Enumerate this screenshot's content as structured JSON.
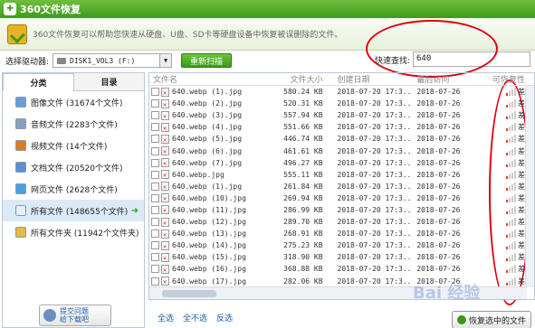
{
  "window": {
    "title": "360文件恢复"
  },
  "banner": {
    "description": "360文件恢复可以帮助您快速从硬盘、U盘、SD卡等硬盘设备中恢复被误删除的文件。"
  },
  "toolbar": {
    "drive_label": "选择驱动器:",
    "drive_value": "DISK1_VOL3 (F:)",
    "rescan_label": "重新扫描",
    "search_label": "快速查找:",
    "search_value": "640"
  },
  "sidebar": {
    "tabs": [
      "分类",
      "目录"
    ],
    "categories": [
      {
        "label": "图像文件 (31674个文件)",
        "icon": "image-icon",
        "color": "#6a9fd4"
      },
      {
        "label": "音频文件 (2283个文件)",
        "icon": "music-icon",
        "color": "#8aa0b8"
      },
      {
        "label": "视频文件 (14个文件)",
        "icon": "video-icon",
        "color": "#e07a1f"
      },
      {
        "label": "文档文件 (20520个文件)",
        "icon": "document-icon",
        "color": "#5b8fd0"
      },
      {
        "label": "网页文件 (2628个文件)",
        "icon": "web-icon",
        "color": "#4aa0e0"
      },
      {
        "label": "所有文件 (148655个文件)",
        "icon": "file-icon",
        "color": "#e8eef5"
      },
      {
        "label": "所有文件夹 (11942个文件夹)",
        "icon": "folder-icon",
        "color": "#e8b84a"
      }
    ],
    "help": {
      "line1": "提交问题",
      "line2": "给下载吧"
    }
  },
  "table": {
    "headers": [
      "文件名",
      "文件大小",
      "创建日期",
      "最后访问",
      "可恢复性"
    ],
    "rows": [
      {
        "name": "640.webp (1).jpg",
        "size": "580.24 KB",
        "created": "2018-07-20 17:3...",
        "accessed": "2018-07-26",
        "recover": "差"
      },
      {
        "name": "640.webp (2).jpg",
        "size": "520.31 KB",
        "created": "2018-07-20 17:3...",
        "accessed": "2018-07-26",
        "recover": "差"
      },
      {
        "name": "640.webp (3).jpg",
        "size": "557.94 KB",
        "created": "2018-07-20 17:3...",
        "accessed": "2018-07-26",
        "recover": "差"
      },
      {
        "name": "640.webp (4).jpg",
        "size": "551.66 KB",
        "created": "2018-07-20 17:3...",
        "accessed": "2018-07-26",
        "recover": "差"
      },
      {
        "name": "640.webp (5).jpg",
        "size": "446.74 KB",
        "created": "2018-07-20 17:3...",
        "accessed": "2018-07-26",
        "recover": "差"
      },
      {
        "name": "640.webp (6).jpg",
        "size": "461.61 KB",
        "created": "2018-07-20 17:3...",
        "accessed": "2018-07-26",
        "recover": "差"
      },
      {
        "name": "640.webp (7).jpg",
        "size": "496.27 KB",
        "created": "2018-07-20 17:3...",
        "accessed": "2018-07-26",
        "recover": "差"
      },
      {
        "name": "640.webp.jpg",
        "size": "555.11 KB",
        "created": "2018-07-20 17:3...",
        "accessed": "2018-07-26",
        "recover": "差"
      },
      {
        "name": "640.webp (1).jpg",
        "size": "261.84 KB",
        "created": "2018-07-20 17:3...",
        "accessed": "2018-07-26",
        "recover": "差"
      },
      {
        "name": "640.webp (10).jpg",
        "size": "269.94 KB",
        "created": "2018-07-20 17:3...",
        "accessed": "2018-07-26",
        "recover": "差"
      },
      {
        "name": "640.webp (11).jpg",
        "size": "286.99 KB",
        "created": "2018-07-20 17:3...",
        "accessed": "2018-07-26",
        "recover": "差"
      },
      {
        "name": "640.webp (12).jpg",
        "size": "289.70 KB",
        "created": "2018-07-20 17:3...",
        "accessed": "2018-07-26",
        "recover": "差"
      },
      {
        "name": "640.webp (13).jpg",
        "size": "268.91 KB",
        "created": "2018-07-20 17:3...",
        "accessed": "2018-07-26",
        "recover": "差"
      },
      {
        "name": "640.webp (14).jpg",
        "size": "275.23 KB",
        "created": "2018-07-20 17:3...",
        "accessed": "2018-07-26",
        "recover": "差"
      },
      {
        "name": "640.webp (15).jpg",
        "size": "318.90 KB",
        "created": "2018-07-20 17:3...",
        "accessed": "2018-07-26",
        "recover": "差"
      },
      {
        "name": "640.webp (16).jpg",
        "size": "368.88 KB",
        "created": "2018-07-20 17:3...",
        "accessed": "2018-07-26",
        "recover": "差"
      },
      {
        "name": "640.webp (17).jpg",
        "size": "282.06 KB",
        "created": "2018-07-20 17:3...",
        "accessed": "2018-07-26",
        "recover": "差"
      }
    ]
  },
  "footer": {
    "select_all": "全选",
    "select_none": "全不选",
    "invert": "反选",
    "recover_label": "恢复选中的文件"
  },
  "watermark": "Bai 经验",
  "colors": {
    "accent": "#3f9a1c",
    "annotation": "#e00010",
    "link": "#1b5db0"
  }
}
